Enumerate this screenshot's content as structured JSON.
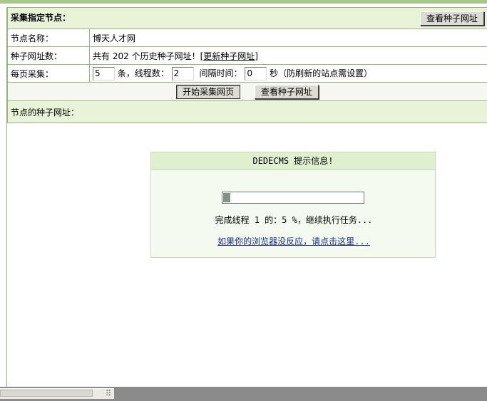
{
  "header": {
    "title": "采集指定节点：",
    "view_seed_button": "查看种子网址"
  },
  "rows": {
    "node_name": {
      "label": "节点名称：",
      "value": "博天人才网"
    },
    "seed_count": {
      "label": "种子网址数：",
      "prefix": "共有",
      "count": "202",
      "suffix": "个历史种子网址！",
      "link_open": "[",
      "link_text": "更新种子网址",
      "link_close": "]"
    },
    "per_page": {
      "label": "每页采集：",
      "per_page_value": "5",
      "per_page_unit": "条，线程数：",
      "threads_value": "2",
      "interval_label": "间隔时间：",
      "interval_value": "0",
      "interval_unit": "秒（防刷新的站点需设置）"
    }
  },
  "actions": {
    "start_button": "开始采集网页",
    "view_seed_button": "查看种子网址"
  },
  "seed_section": {
    "title": "节点的种子网址："
  },
  "message_box": {
    "title": "DEDECMS 提示信息!",
    "progress_fraction": 0.05,
    "status_text": "完成线程 1 的：5 %，继续执行任务...",
    "link_text": "如果你的浏览器没反应，请点击这里..."
  },
  "icons": {
    "scroll_grip": "resize-grip-icon"
  }
}
